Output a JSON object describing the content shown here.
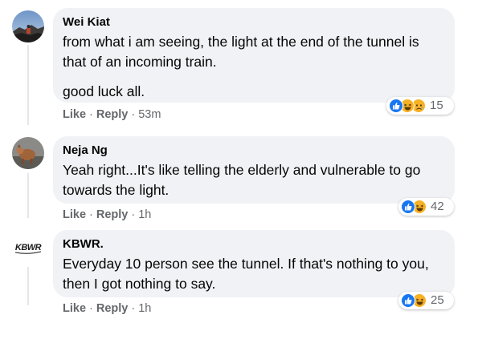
{
  "comments": [
    {
      "author": "Wei Kiat",
      "paragraphs": [
        "from what i am seeing, the light at the end of the tunnel is that of an incoming train.",
        "good luck all."
      ],
      "actions": {
        "like": "Like",
        "reply": "Reply",
        "separator": "·",
        "time": "53m"
      },
      "reactions": {
        "icons": [
          "like-reaction-icon",
          "haha-reaction-icon",
          "sad-reaction-icon"
        ],
        "count": "15"
      },
      "avatar": "landscape-photo"
    },
    {
      "author": "Neja Ng",
      "paragraphs": [
        "Yeah right...It's like telling the elderly and vulnerable to go towards the light."
      ],
      "actions": {
        "like": "Like",
        "reply": "Reply",
        "separator": "·",
        "time": "1h"
      },
      "reactions": {
        "icons": [
          "like-reaction-icon",
          "haha-reaction-icon"
        ],
        "count": "42"
      },
      "avatar": "animal-photo"
    },
    {
      "author": "KBWR.",
      "paragraphs": [
        "Everyday 10 person see the tunnel. If that's nothing to you, then I got nothing to say."
      ],
      "actions": {
        "like": "Like",
        "reply": "Reply",
        "separator": "·",
        "time": "1h"
      },
      "reactions": {
        "icons": [
          "like-reaction-icon",
          "haha-reaction-icon"
        ],
        "count": "25"
      },
      "avatar": {
        "logo_text": "KBWR"
      }
    }
  ],
  "colors": {
    "bubble": "#f0f2f5",
    "secondary_text": "#65676b",
    "like_blue": "#1877f2",
    "reaction_yellow": "#f7b125"
  }
}
